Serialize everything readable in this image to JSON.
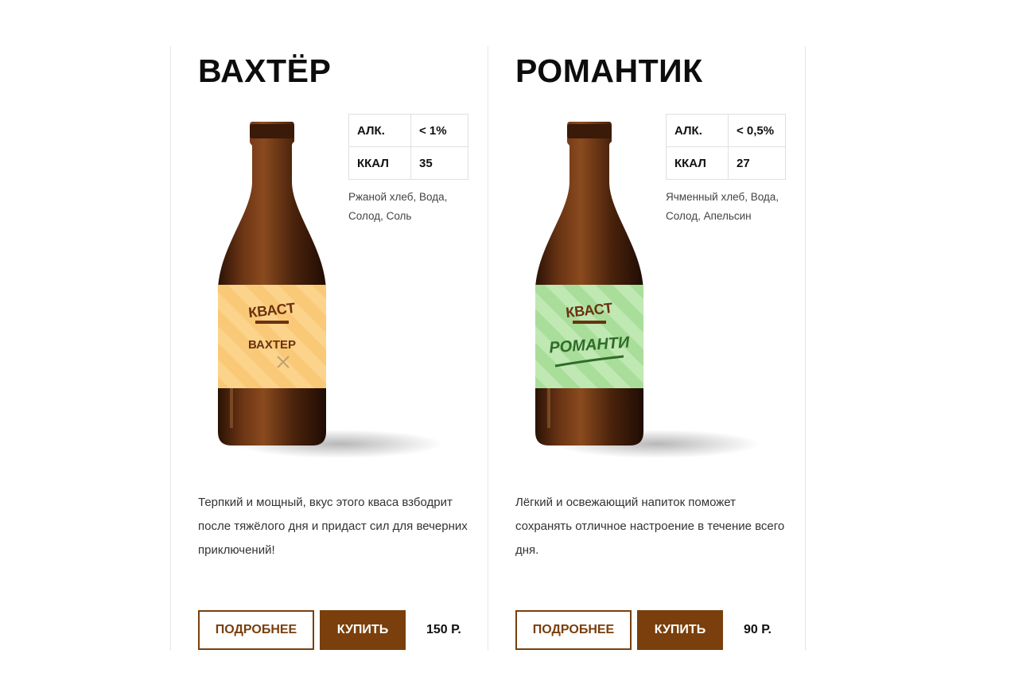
{
  "products": [
    {
      "title": "ВАХТЁР",
      "specs": [
        {
          "label": "АЛК.",
          "value": "< 1%"
        },
        {
          "label": "ККАЛ",
          "value": "35"
        }
      ],
      "ingredients": "Ржаной хлеб, Вода, Солод, Соль",
      "description": "Терпкий и мощный, вкус этого кваса взбодрит после тяжёлого дня и придаст сил для вечерних приключений!",
      "more_label": "ПОДРОБНЕЕ",
      "buy_label": "КУПИТЬ",
      "price": "150 Р.",
      "bottle_label": {
        "brand": "КВАСТ",
        "name": "ВАХТЕР",
        "colors": {
          "label_bg": "#fcd38a",
          "text": "#6b3110"
        }
      }
    },
    {
      "title": "РОМАНТИК",
      "specs": [
        {
          "label": "АЛК.",
          "value": "< 0,5%"
        },
        {
          "label": "ККАЛ",
          "value": "27"
        }
      ],
      "ingredients": "Ячменный хлеб, Вода, Солод, Апельсин",
      "description": "Лёгкий и освежающий напиток поможет сохранять отличное настроение в течение всего дня.",
      "more_label": "ПОДРОБНЕЕ",
      "buy_label": "КУПИТЬ",
      "price": "90 Р.",
      "bottle_label": {
        "brand": "КВАСТ",
        "name": "РОМАНТИ",
        "colors": {
          "label_bg": "#bfe8b2",
          "text": "#2f6b2a"
        }
      }
    }
  ],
  "colors": {
    "accent": "#7a3f0c",
    "glass": "#4a230c",
    "divider": "#e6e6e6"
  }
}
